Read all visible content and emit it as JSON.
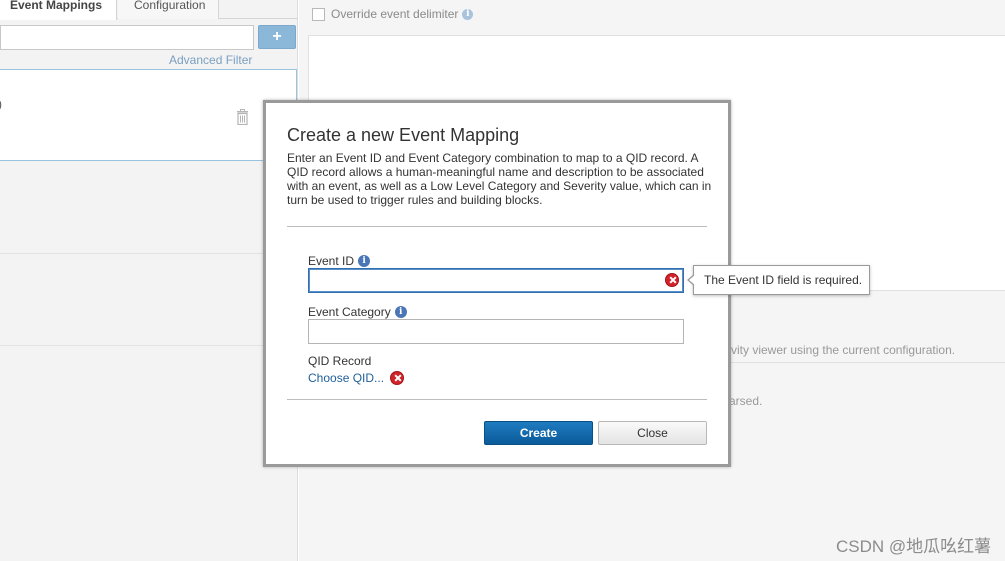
{
  "tabs": [
    {
      "label": "Event Mappings",
      "active": true
    },
    {
      "label": "Configuration",
      "active": false
    }
  ],
  "left": {
    "add_button_label": "+",
    "advanced_filter_label": "Advanced Filter",
    "card_fragment": ")"
  },
  "right": {
    "override_label": "Override event delimiter",
    "bg_text_1": "ctivity viewer using the current configuration.",
    "bg_text_2": "arsed."
  },
  "modal": {
    "title": "Create a new Event Mapping",
    "description": "Enter an Event ID and Event Category combination to map to a QID record. A QID record allows a human-meaningful name and description to be associated with an event, as well as a Low Level Category and Severity value, which can in turn be used to trigger rules and building blocks.",
    "event_id_label": "Event ID",
    "event_id_value": "",
    "event_category_label": "Event Category",
    "event_category_value": "",
    "qid_record_label": "QID Record",
    "choose_qid_label": "Choose QID...",
    "create_label": "Create",
    "close_label": "Close",
    "error_tooltip": "The Event ID field is required."
  },
  "watermark": "CSDN @地瓜吆红薯",
  "colors": {
    "accent": "#0b62a4",
    "error": "#d2232a",
    "link": "#1f5f9a",
    "info": "#4a76b8"
  }
}
